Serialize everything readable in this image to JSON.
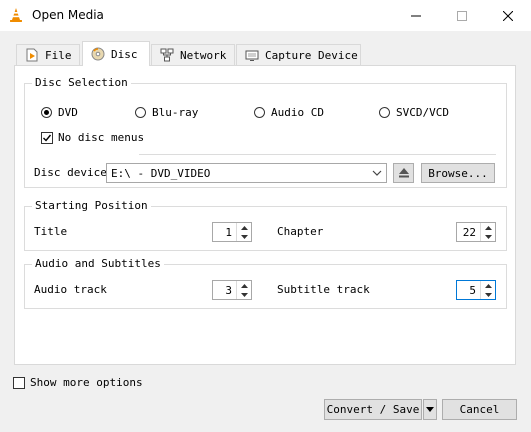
{
  "window": {
    "title": "Open Media"
  },
  "tabs": [
    {
      "label": "File",
      "icon": "file-icon"
    },
    {
      "label": "Disc",
      "icon": "disc-icon",
      "active": true
    },
    {
      "label": "Network",
      "icon": "network-icon"
    },
    {
      "label": "Capture Device",
      "icon": "capture-device-icon"
    }
  ],
  "disc_selection": {
    "legend": "Disc Selection",
    "options": [
      {
        "label": "DVD",
        "selected": true
      },
      {
        "label": "Blu-ray",
        "selected": false
      },
      {
        "label": "Audio CD",
        "selected": false
      },
      {
        "label": "SVCD/VCD",
        "selected": false
      }
    ],
    "no_disc_menus": {
      "label": "No disc menus",
      "checked": true
    },
    "device_label": "Disc device",
    "device_value": "E:\\ - DVD_VIDEO",
    "browse_label": "Browse..."
  },
  "starting_position": {
    "legend": "Starting Position",
    "title_label": "Title",
    "title_value": "1",
    "chapter_label": "Chapter",
    "chapter_value": "22"
  },
  "audio_subs": {
    "legend": "Audio and Subtitles",
    "audio_label": "Audio track",
    "audio_value": "3",
    "subtitle_label": "Subtitle track",
    "subtitle_value": "5"
  },
  "show_more": {
    "label": "Show more options",
    "checked": false
  },
  "footer": {
    "convert_label": "Convert / Save",
    "cancel_label": "Cancel"
  },
  "colors": {
    "focus": "#0078d7",
    "vlc_orange": "#f08c00"
  }
}
